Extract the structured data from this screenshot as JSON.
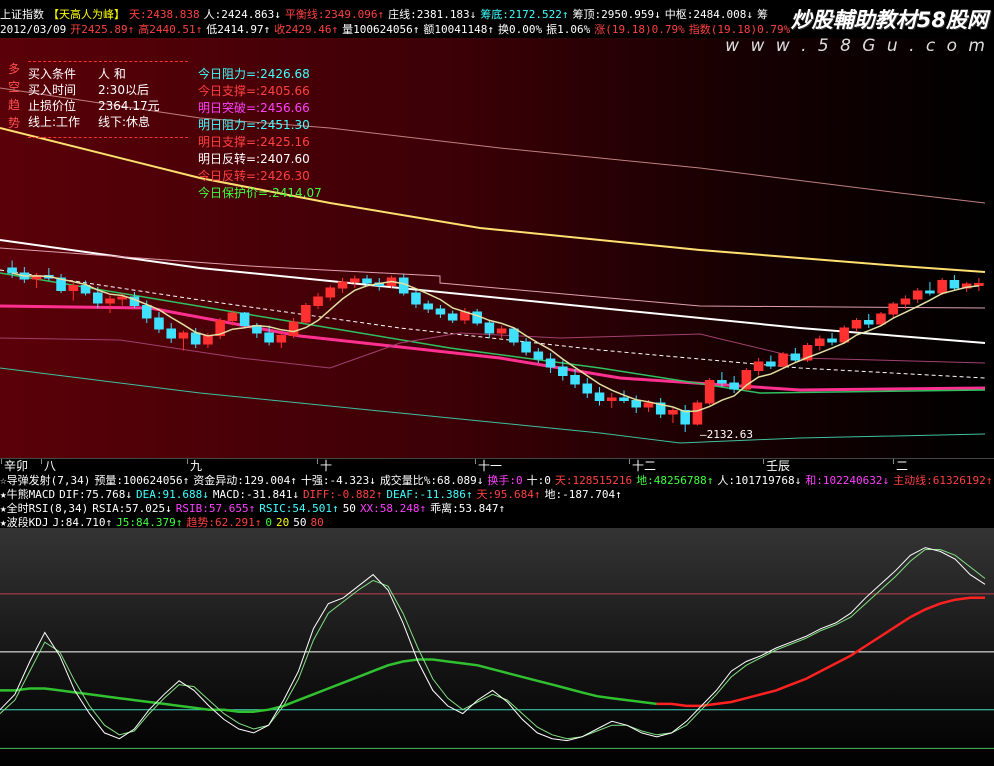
{
  "header": {
    "row1": [
      {
        "t": "上证指数",
        "c": "wh"
      },
      {
        "t": "【天高人为峰】",
        "c": "yl"
      },
      {
        "t": "天:2438.838",
        "c": "up"
      },
      {
        "t": "人:2424.863↓",
        "c": "wh"
      },
      {
        "t": "平衡线:2349.096↑",
        "c": "up"
      },
      {
        "t": "庄线:2381.183↓",
        "c": "wh"
      },
      {
        "t": "筹底:2172.522↑",
        "c": "cy"
      },
      {
        "t": "筹顶:2950.959↓",
        "c": "wh"
      },
      {
        "t": "中枢:2484.008↓",
        "c": "wh"
      },
      {
        "t": "筹",
        "c": "wh"
      }
    ],
    "row2": [
      {
        "t": "2012/03/09",
        "c": "wh"
      },
      {
        "t": "开2425.89↑",
        "c": "up"
      },
      {
        "t": "高2440.51↑",
        "c": "up"
      },
      {
        "t": "低2414.97↑",
        "c": "wh"
      },
      {
        "t": "收2429.46↑",
        "c": "up"
      },
      {
        "t": "量100624056↑",
        "c": "wh"
      },
      {
        "t": "额10041148↑",
        "c": "wh"
      },
      {
        "t": "换0.00%",
        "c": "wh"
      },
      {
        "t": "振1.06%",
        "c": "wh"
      },
      {
        "t": "涨(19.18)0.79%",
        "c": "up"
      },
      {
        "t": "指数(19.18)0.79%",
        "c": "up"
      }
    ]
  },
  "watermark": {
    "title": "炒股輔助教材58股网",
    "url": "w w w . 5 8 G u . c o m"
  },
  "side_tag": "多空趋势",
  "conditions": [
    {
      "k": "买入条件",
      "v": "人  和"
    },
    {
      "k": "买入时间",
      "v": "2:30以后"
    },
    {
      "k": "止损价位",
      "v": "2364.17元"
    },
    {
      "k": "线上:工作",
      "v": "线下:休息"
    }
  ],
  "levels": [
    {
      "t": "今日阻力=:2426.68",
      "color": "#40ffff"
    },
    {
      "t": "今日支撑=:2405.66",
      "color": "#ff4040"
    },
    {
      "t": "明日突破=:2456.66",
      "color": "#ff40ff"
    },
    {
      "t": "明日阻力=:2451.30",
      "color": "#40ffff"
    },
    {
      "t": "明日支撑=:2425.16",
      "color": "#ff4040"
    },
    {
      "t": "明日反转=:2407.60",
      "color": "#ffffff"
    },
    {
      "t": "今日反转=:2426.30",
      "color": "#ff4040"
    },
    {
      "t": "今日保护价=:2414.07",
      "color": "#40ff40"
    }
  ],
  "low_label": "2132.63",
  "time_axis": [
    "辛卯",
    "八",
    "九",
    "十",
    "十一",
    "十二",
    "壬辰",
    "二"
  ],
  "indicators": {
    "row1": [
      {
        "t": "☆导弹发射(7,34)",
        "c": "wh"
      },
      {
        "t": "预量:100624056↑",
        "c": "wh"
      },
      {
        "t": "资金异动:129.004↑",
        "c": "wh"
      },
      {
        "t": "十强:-4.323↓",
        "c": "wh"
      },
      {
        "t": "成交量比%:68.089↓",
        "c": "wh"
      },
      {
        "t": "换手:0",
        "c": "mg"
      },
      {
        "t": "十:0",
        "c": "wh"
      },
      {
        "t": "天:128515216",
        "c": "up"
      },
      {
        "t": "地:48256788↑",
        "c": "dn"
      },
      {
        "t": "人:101719768↓",
        "c": "wh"
      },
      {
        "t": "和:102240632↓",
        "c": "mg"
      },
      {
        "t": "主动线:61326192↑",
        "c": "up"
      }
    ],
    "row2": [
      {
        "t": "★牛熊MACD",
        "c": "wh"
      },
      {
        "t": "DIF:75.768↓",
        "c": "wh"
      },
      {
        "t": "DEA:91.688↓",
        "c": "cy"
      },
      {
        "t": "MACD:-31.841↓",
        "c": "wh"
      },
      {
        "t": "DIFF:-0.882↑",
        "c": "up"
      },
      {
        "t": "DEAF:-11.386↑",
        "c": "cy"
      },
      {
        "t": "天:95.684↑",
        "c": "up"
      },
      {
        "t": "地:-187.704↑",
        "c": "wh"
      }
    ],
    "row3": [
      {
        "t": "★全时RSI(8,34)",
        "c": "wh"
      },
      {
        "t": "RSIA:57.025↓",
        "c": "wh"
      },
      {
        "t": "RSIB:57.655↑",
        "c": "mg"
      },
      {
        "t": "RSIC:54.501↑",
        "c": "cy"
      },
      {
        "t": "50",
        "c": "wh"
      },
      {
        "t": "XX:58.248↑",
        "c": "mg"
      },
      {
        "t": "乖离:53.847↑",
        "c": "wh"
      }
    ],
    "row4": [
      {
        "t": "★波段KDJ",
        "c": "wh"
      },
      {
        "t": "J:84.710↑",
        "c": "wh"
      },
      {
        "t": "J5:84.379↑",
        "c": "dn"
      },
      {
        "t": "趋势:62.291↑",
        "c": "up"
      },
      {
        "t": "0",
        "c": "dn"
      },
      {
        "t": "20",
        "c": "yl"
      },
      {
        "t": "50",
        "c": "wh"
      },
      {
        "t": "80",
        "c": "up"
      }
    ]
  },
  "chart_data": {
    "type": "candlestick",
    "ylim": [
      2100,
      2900
    ],
    "candles": [
      [
        2460,
        2475,
        2440,
        2450
      ],
      [
        2450,
        2462,
        2430,
        2438
      ],
      [
        2438,
        2450,
        2420,
        2445
      ],
      [
        2445,
        2460,
        2435,
        2440
      ],
      [
        2440,
        2448,
        2410,
        2415
      ],
      [
        2415,
        2430,
        2395,
        2425
      ],
      [
        2425,
        2435,
        2405,
        2410
      ],
      [
        2410,
        2422,
        2380,
        2390
      ],
      [
        2390,
        2405,
        2370,
        2398
      ],
      [
        2398,
        2410,
        2385,
        2402
      ],
      [
        2402,
        2412,
        2380,
        2385
      ],
      [
        2385,
        2395,
        2350,
        2360
      ],
      [
        2360,
        2372,
        2330,
        2338
      ],
      [
        2338,
        2350,
        2310,
        2320
      ],
      [
        2320,
        2335,
        2295,
        2330
      ],
      [
        2330,
        2340,
        2300,
        2308
      ],
      [
        2308,
        2330,
        2300,
        2325
      ],
      [
        2325,
        2360,
        2318,
        2355
      ],
      [
        2355,
        2375,
        2345,
        2370
      ],
      [
        2370,
        2372,
        2340,
        2345
      ],
      [
        2345,
        2350,
        2320,
        2330
      ],
      [
        2330,
        2345,
        2305,
        2312
      ],
      [
        2312,
        2330,
        2300,
        2325
      ],
      [
        2325,
        2360,
        2320,
        2352
      ],
      [
        2352,
        2390,
        2348,
        2385
      ],
      [
        2385,
        2410,
        2378,
        2402
      ],
      [
        2402,
        2425,
        2395,
        2420
      ],
      [
        2420,
        2440,
        2410,
        2432
      ],
      [
        2432,
        2445,
        2420,
        2438
      ],
      [
        2438,
        2446,
        2425,
        2430
      ],
      [
        2430,
        2440,
        2415,
        2425
      ],
      [
        2425,
        2445,
        2420,
        2440
      ],
      [
        2440,
        2448,
        2405,
        2410
      ],
      [
        2410,
        2415,
        2380,
        2388
      ],
      [
        2388,
        2395,
        2370,
        2378
      ],
      [
        2378,
        2386,
        2360,
        2368
      ],
      [
        2368,
        2375,
        2350,
        2356
      ],
      [
        2356,
        2380,
        2348,
        2372
      ],
      [
        2372,
        2378,
        2345,
        2350
      ],
      [
        2350,
        2356,
        2320,
        2330
      ],
      [
        2330,
        2345,
        2320,
        2338
      ],
      [
        2338,
        2342,
        2305,
        2312
      ],
      [
        2312,
        2320,
        2285,
        2292
      ],
      [
        2292,
        2300,
        2270,
        2278
      ],
      [
        2278,
        2290,
        2250,
        2262
      ],
      [
        2262,
        2275,
        2235,
        2245
      ],
      [
        2245,
        2258,
        2220,
        2228
      ],
      [
        2228,
        2240,
        2200,
        2210
      ],
      [
        2210,
        2222,
        2185,
        2195
      ],
      [
        2195,
        2210,
        2180,
        2200
      ],
      [
        2200,
        2215,
        2190,
        2195
      ],
      [
        2195,
        2205,
        2170,
        2182
      ],
      [
        2182,
        2196,
        2172,
        2190
      ],
      [
        2190,
        2200,
        2160,
        2168
      ],
      [
        2168,
        2180,
        2150,
        2175
      ],
      [
        2175,
        2186,
        2132,
        2148
      ],
      [
        2148,
        2195,
        2145,
        2190
      ],
      [
        2190,
        2240,
        2186,
        2235
      ],
      [
        2235,
        2252,
        2222,
        2230
      ],
      [
        2230,
        2244,
        2210,
        2218
      ],
      [
        2218,
        2260,
        2214,
        2255
      ],
      [
        2255,
        2280,
        2245,
        2272
      ],
      [
        2272,
        2285,
        2258,
        2264
      ],
      [
        2264,
        2292,
        2260,
        2288
      ],
      [
        2288,
        2300,
        2270,
        2276
      ],
      [
        2276,
        2310,
        2272,
        2305
      ],
      [
        2305,
        2325,
        2295,
        2318
      ],
      [
        2318,
        2330,
        2305,
        2312
      ],
      [
        2312,
        2345,
        2308,
        2340
      ],
      [
        2340,
        2360,
        2332,
        2355
      ],
      [
        2355,
        2368,
        2340,
        2348
      ],
      [
        2348,
        2372,
        2345,
        2368
      ],
      [
        2368,
        2392,
        2360,
        2388
      ],
      [
        2388,
        2405,
        2378,
        2398
      ],
      [
        2398,
        2420,
        2390,
        2414
      ],
      [
        2414,
        2432,
        2405,
        2410
      ],
      [
        2410,
        2440,
        2406,
        2435
      ],
      [
        2435,
        2446,
        2415,
        2420
      ],
      [
        2420,
        2432,
        2412,
        2428
      ],
      [
        2425,
        2440,
        2414,
        2429
      ]
    ]
  },
  "osc_data": {
    "ylim": [
      -5,
      110
    ],
    "white_j": [
      20,
      28,
      45,
      60,
      48,
      30,
      18,
      8,
      5,
      10,
      20,
      28,
      35,
      30,
      22,
      15,
      10,
      8,
      12,
      25,
      40,
      62,
      75,
      78,
      84,
      90,
      82,
      65,
      45,
      30,
      22,
      18,
      25,
      30,
      24,
      15,
      8,
      5,
      4,
      6,
      10,
      14,
      12,
      8,
      6,
      8,
      14,
      22,
      30,
      40,
      45,
      48,
      52,
      55,
      58,
      62,
      65,
      70,
      78,
      85,
      92,
      100,
      104,
      102,
      98,
      90,
      85
    ],
    "gray_j5": [
      18,
      25,
      40,
      55,
      50,
      35,
      22,
      12,
      7,
      9,
      18,
      26,
      33,
      32,
      25,
      18,
      13,
      10,
      12,
      22,
      36,
      56,
      70,
      76,
      82,
      87,
      84,
      70,
      52,
      36,
      26,
      20,
      24,
      28,
      25,
      18,
      11,
      7,
      5,
      6,
      9,
      12,
      12,
      9,
      7,
      8,
      12,
      20,
      28,
      37,
      43,
      47,
      51,
      54,
      57,
      61,
      64,
      68,
      75,
      82,
      89,
      97,
      103,
      103,
      100,
      94,
      88
    ],
    "trend": [
      30,
      30,
      31,
      31,
      30,
      29,
      28,
      27,
      26,
      25,
      24,
      23,
      22,
      21,
      20,
      20,
      19,
      19,
      20,
      22,
      25,
      28,
      31,
      34,
      37,
      40,
      43,
      45,
      46,
      46,
      45,
      44,
      43,
      41,
      39,
      37,
      35,
      33,
      31,
      29,
      27,
      26,
      25,
      24,
      23,
      23,
      22,
      22,
      23,
      24,
      26,
      28,
      30,
      33,
      36,
      40,
      44,
      48,
      53,
      58,
      63,
      68,
      72,
      75,
      77,
      78,
      78
    ],
    "hlines": [
      80,
      50,
      20,
      0
    ]
  }
}
